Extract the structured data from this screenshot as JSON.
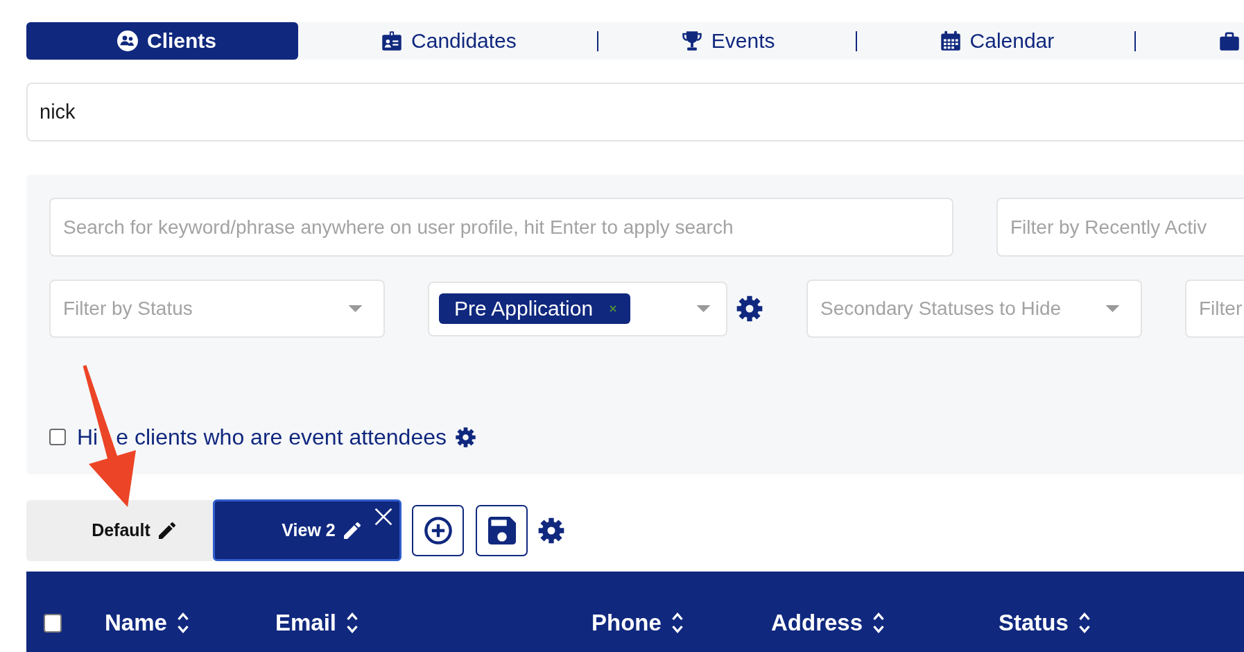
{
  "tabs": [
    {
      "label": "Clients",
      "selected": true
    },
    {
      "label": "Candidates",
      "selected": false
    },
    {
      "label": "Events",
      "selected": false
    },
    {
      "label": "Calendar",
      "selected": false
    },
    {
      "selected": false
    }
  ],
  "search": {
    "value": "nick"
  },
  "filters": {
    "keyword": {
      "placeholder": "Search for keyword/phrase anywhere on user profile, hit Enter to apply search"
    },
    "recently_active": {
      "placeholder": "Filter by Recently Activ"
    },
    "status": {
      "placeholder": "Filter by Status"
    },
    "statuses": {
      "tags": [
        {
          "label": "Pre Application"
        }
      ]
    },
    "secondary_statuses": {
      "placeholder": "Secondary Statuses to Hide"
    },
    "column_5": {
      "placeholder": "Filter"
    },
    "hide_event_attendees": {
      "checked": false,
      "label_parts": [
        "Hi",
        "e clients who are event attendees"
      ]
    }
  },
  "views": [
    {
      "label": "Default",
      "selected": false,
      "closable": false
    },
    {
      "label": "View 2",
      "selected": true,
      "closable": true
    }
  ],
  "table": {
    "select_all": {
      "checked": false
    },
    "columns": [
      {
        "label": "Name"
      },
      {
        "label": "Email"
      },
      {
        "label": "Phone"
      },
      {
        "label": "Address"
      },
      {
        "label": "Status"
      }
    ]
  }
}
